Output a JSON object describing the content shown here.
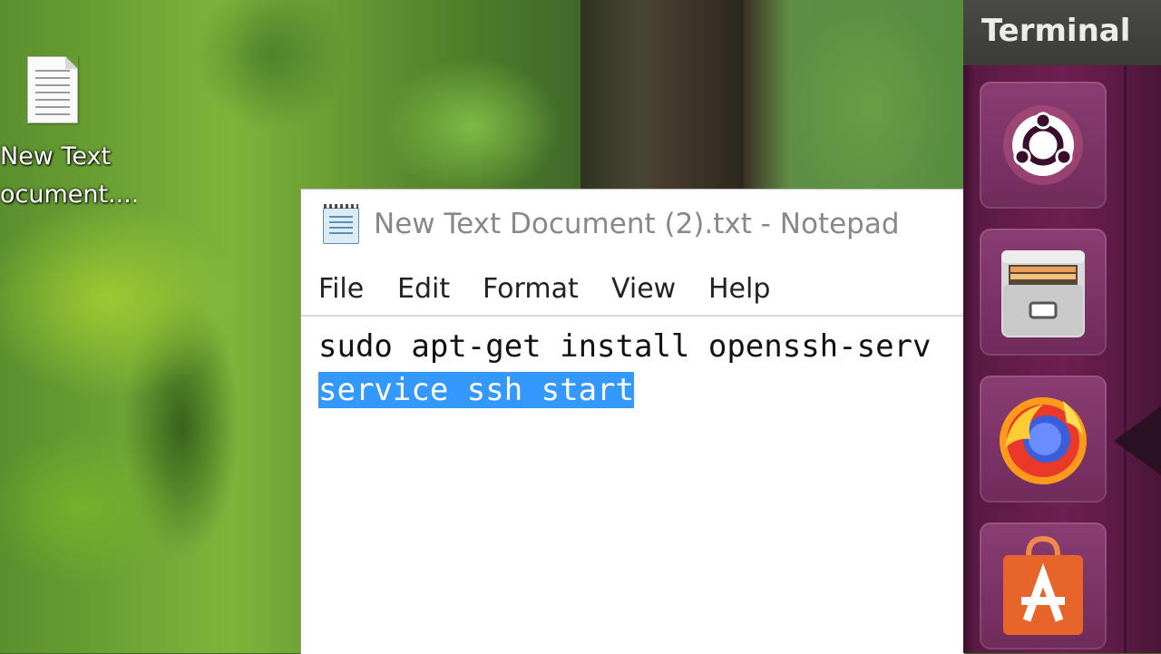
{
  "desktop": {
    "icon_label_line1": "New Text",
    "icon_label_line2": "ocument...."
  },
  "notepad": {
    "title": "New Text Document (2).txt - Notepad",
    "menu": [
      "File",
      "Edit",
      "Format",
      "View",
      "Help"
    ],
    "lines": [
      "sudo apt-get install openssh-serv",
      "service ssh start"
    ],
    "selected_line_index": 1,
    "selection_color": "#3399ff"
  },
  "ubuntu": {
    "top_bar_title": "Terminal",
    "launcher_items": [
      "ubuntu-icon",
      "files-icon",
      "firefox-icon",
      "software-center-icon"
    ],
    "launcher_color": "#6e1f52"
  }
}
